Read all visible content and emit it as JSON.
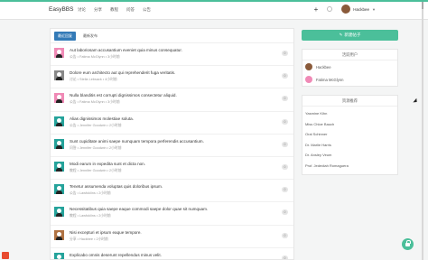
{
  "navbar": {
    "brand": "EasyBBS",
    "links": [
      "讨论",
      "分享",
      "教程",
      "问答",
      "公告"
    ],
    "user": "Hackbee"
  },
  "tabs": [
    {
      "label": "最近回复"
    },
    {
      "label": "最新发布"
    }
  ],
  "posts": [
    {
      "title": "Aut laboriosam accusantium eveniet quia minus consequatur.",
      "meta": "公告 • Fatima McGlynn • 3小时前",
      "count": "0",
      "avatar": "pink"
    },
    {
      "title": "Dolore eum architecto aut qui reprehenderit fuga veritatis.",
      "meta": "讨论 • Stella Lebsack • 4小时前",
      "count": "0",
      "avatar": "gray"
    },
    {
      "title": "Nulla blanditis est corrupti dignissimos consectetur aliquid.",
      "meta": "公告 • Fatima McGlynn • 3小时前",
      "count": "0",
      "avatar": "pink"
    },
    {
      "title": "Alias dignissimos molestiae soluta.",
      "meta": "公告 • Jennifer Goodwin • 2小时前",
      "count": "0",
      "avatar": "teal"
    },
    {
      "title": "Sunt cupiditate animi saepe numquam tempora perferendis accusantium.",
      "meta": "问答 • Jennifer Goodwin • 2小时前",
      "count": "0",
      "avatar": "teal"
    },
    {
      "title": "Modi earum in expedita sunt et dicta non.",
      "meta": "教程 • Jennifer Goodwin • 2小时前",
      "count": "0",
      "avatar": "teal"
    },
    {
      "title": "Tenetur assumenda voluptas quis doloribus ipsum.",
      "meta": "公告 • Lawfoklins • 2小时前",
      "count": "0",
      "avatar": "teal"
    },
    {
      "title": "Necessitatibus quia saepe eaque commodi saepe dolor quae sit numquam.",
      "meta": "教程 • Lawfoklins • 2小时前",
      "count": "0",
      "avatar": "teal"
    },
    {
      "title": "Nisi excepturi et ipsum eaque tempore.",
      "meta": "分享 • Hackbee • 2小时前",
      "count": "0",
      "avatar": "brown"
    },
    {
      "title": "Explicabo omnis deserunt repellendus minus velit.",
      "meta": "教程 • Lawfoklins • 2小时前",
      "count": "0",
      "avatar": "teal"
    }
  ],
  "sidebar": {
    "new_button": "新建帖子",
    "active_users_title": "活跃用户",
    "active_users": [
      {
        "name": "Hackbee",
        "color": "#8a5a3a"
      },
      {
        "name": "Fatima McGlynn",
        "color": "#f08ab6"
      }
    ],
    "recommend_title": "资源推荐",
    "recommend": [
      "Yasmine Kihn",
      "Miss Chloe Bauch",
      "Oral Schinner",
      "Dr. Marlie Harris",
      "Dr. Ansley Veum",
      "Prof. Jedediah Romaguera"
    ]
  }
}
